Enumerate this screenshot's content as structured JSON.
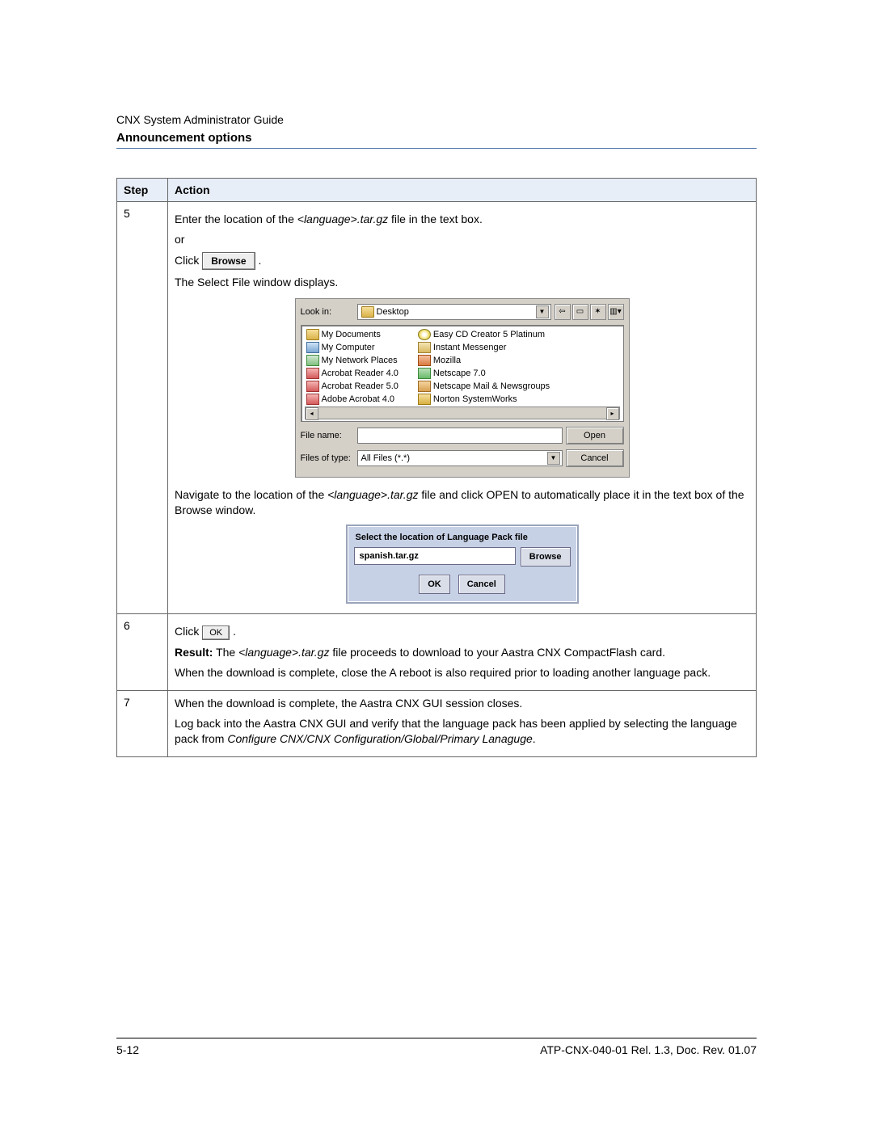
{
  "doc_header": "CNX System Administrator Guide",
  "section_title": "Announcement options",
  "table_headers": {
    "step": "Step",
    "action": "Action"
  },
  "step5": {
    "num": "5",
    "line1a": "Enter the location of the ",
    "line1b": "<language>.tar.gz",
    "line1c": " file in the text box.",
    "or": "or",
    "click": "Click ",
    "browse_btn": "Browse",
    "period": " .",
    "line3": "The Select File window displays.",
    "nav_a": "Navigate to the location of the ",
    "nav_b": "<language>.tar.gz",
    "nav_c": " file and click OPEN to automatically place it in the text box of the Browse window."
  },
  "file_dialog": {
    "lookin_label": "Look in:",
    "lookin_value": "Desktop",
    "files_left": [
      {
        "ico": "folder",
        "name": "My Documents"
      },
      {
        "ico": "comp",
        "name": "My Computer"
      },
      {
        "ico": "net",
        "name": "My Network Places"
      },
      {
        "ico": "pdf",
        "name": "Acrobat Reader 4.0"
      },
      {
        "ico": "pdf",
        "name": "Acrobat Reader 5.0"
      },
      {
        "ico": "pdf",
        "name": "Adobe Acrobat 4.0"
      }
    ],
    "files_right": [
      {
        "ico": "cd",
        "name": "Easy CD Creator 5 Platinum"
      },
      {
        "ico": "msg",
        "name": "Instant Messenger"
      },
      {
        "ico": "moz",
        "name": "Mozilla"
      },
      {
        "ico": "ns",
        "name": "Netscape 7.0"
      },
      {
        "ico": "mail",
        "name": "Netscape Mail & Newsgroups"
      },
      {
        "ico": "nsw",
        "name": "Norton SystemWorks"
      }
    ],
    "filename_label": "File name:",
    "filename_value": "",
    "filetype_label": "Files of type:",
    "filetype_value": "All Files (*.*)",
    "open_btn": "Open",
    "cancel_btn": "Cancel"
  },
  "lang_dialog": {
    "title": "Select the location of Language Pack file",
    "value": "spanish.tar.gz",
    "browse": "Browse",
    "ok": "OK",
    "cancel": "Cancel"
  },
  "step6": {
    "num": "6",
    "click": "Click ",
    "ok_btn": "OK",
    "period": " .",
    "result_label": "Result:",
    "result_a": " The ",
    "result_b": "<language>.tar.gz",
    "result_c": " file proceeds to download to your Aastra CNX CompactFlash card.",
    "line3": "When the download is complete, close the A reboot is also required prior to loading another language pack."
  },
  "step7": {
    "num": "7",
    "line1": "When the download is complete, the Aastra CNX GUI session closes.",
    "line2": "Log back into the Aastra CNX GUI and verify that the language pack has been applied by selecting the language pack from ",
    "line2_italic": "Configure CNX/CNX Configuration/Global/Primary Lanaguge",
    "line2_end": "."
  },
  "footer": {
    "page": "5-12",
    "docref": "ATP-CNX-040-01 Rel. 1.3, Doc. Rev. 01.07"
  }
}
